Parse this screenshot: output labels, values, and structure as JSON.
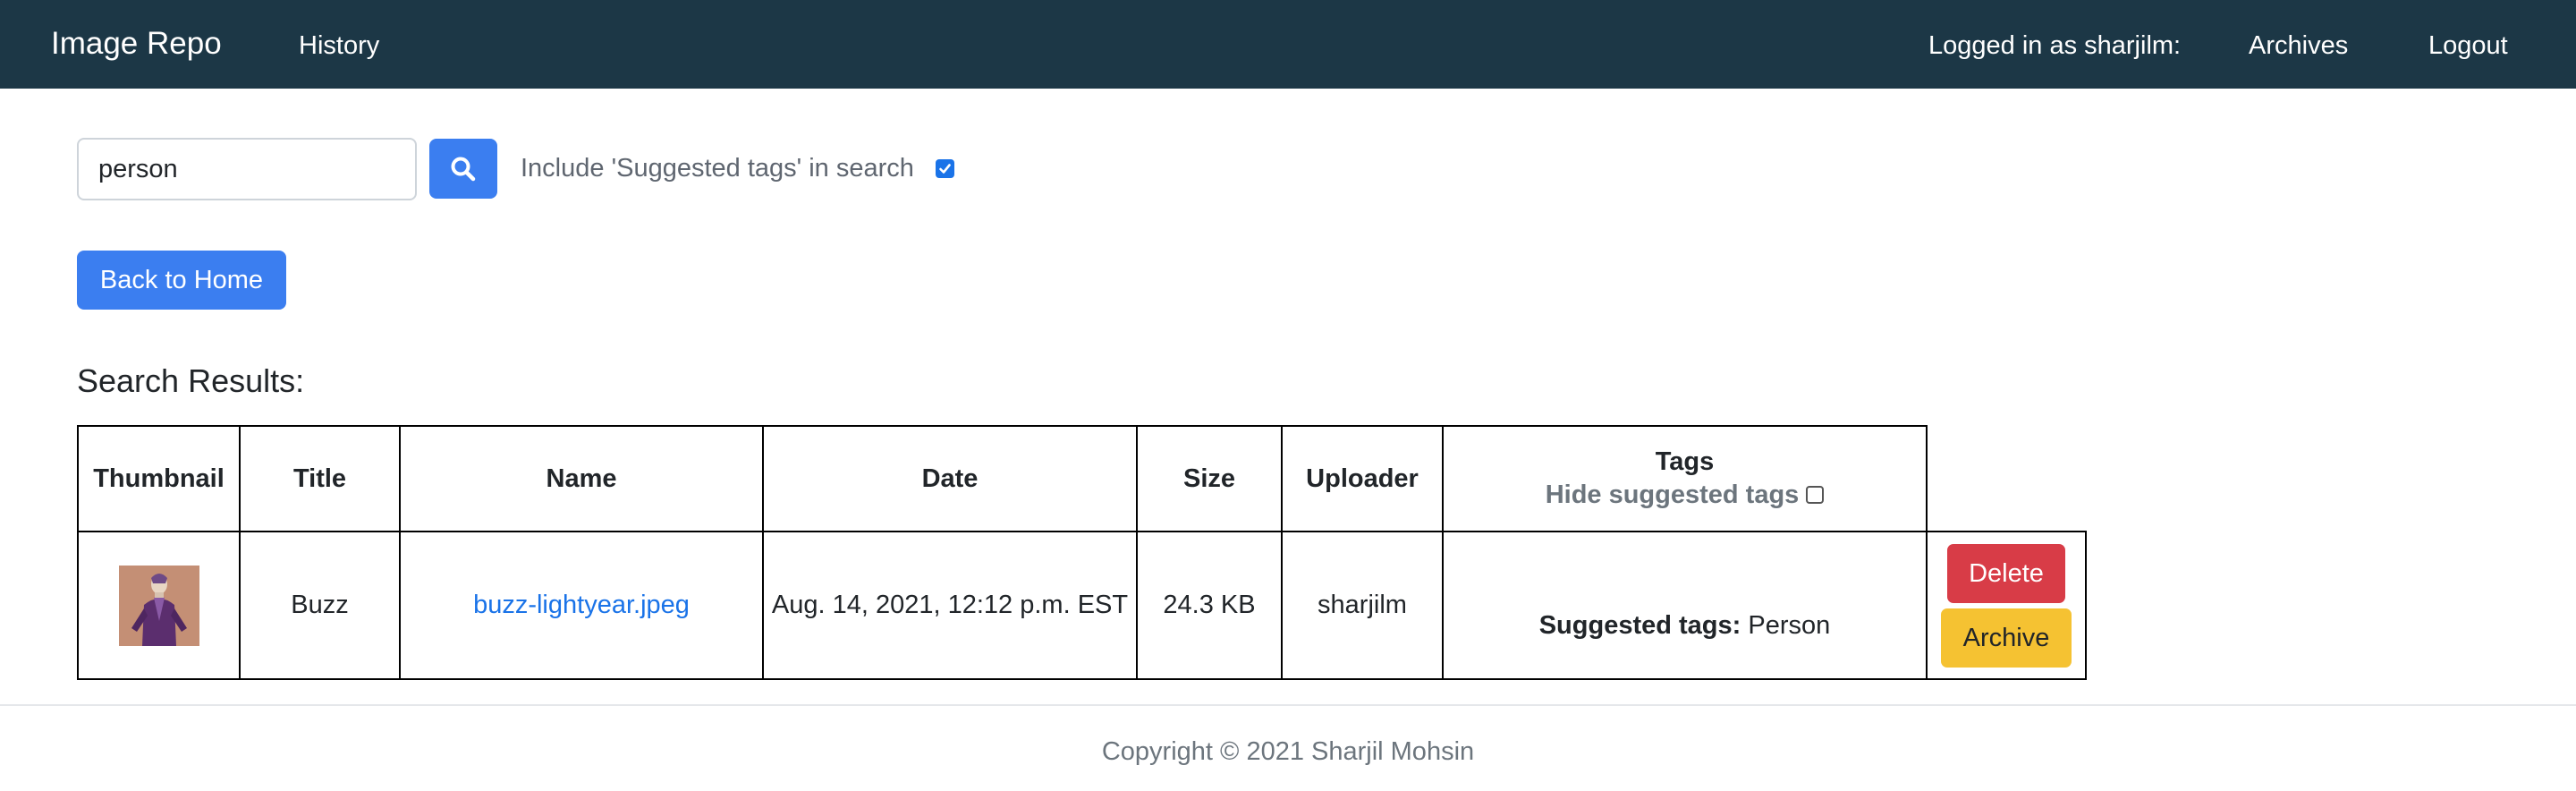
{
  "navbar": {
    "brand": "Image Repo",
    "history": "History",
    "logged_in": "Logged in as sharjilm:",
    "archives": "Archives",
    "logout": "Logout"
  },
  "search": {
    "value": "person",
    "include_label": "Include 'Suggested tags' in search",
    "include_checked": true
  },
  "home_button": "Back to Home",
  "results_heading": "Search Results:",
  "table": {
    "headers": {
      "thumbnail": "Thumbnail",
      "title": "Title",
      "name": "Name",
      "date": "Date",
      "size": "Size",
      "uploader": "Uploader",
      "tags": "Tags",
      "hide_suggested": "Hide suggested tags"
    },
    "rows": [
      {
        "title": "Buzz",
        "name": "buzz-lightyear.jpeg",
        "date": "Aug. 14, 2021, 12:12 p.m. EST",
        "size": "24.3 KB",
        "uploader": "sharjilm",
        "suggested_label": "Suggested tags:",
        "suggested_value": " Person",
        "delete_label": "Delete",
        "archive_label": "Archive"
      }
    ]
  },
  "footer": "Copyright © 2021 Sharjil Mohsin",
  "colors": {
    "navbar": "#1c3746",
    "primary": "#3b7ef0",
    "danger": "#d83c47",
    "warning": "#f5c232",
    "link": "#1a73e8"
  },
  "icons": {
    "search": "search-icon",
    "checkbox": "checkbox-icon"
  }
}
